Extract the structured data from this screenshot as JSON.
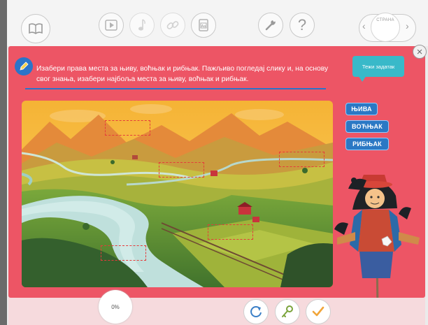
{
  "page_indicator": {
    "label": "СТРАНА"
  },
  "instruction": {
    "text": "Изабери права места за њиву, воћњак и рибњак. Пажљиво погледај слику и, на основу свог знања, изабери најбоља места за њиву, воћњак и рибњак."
  },
  "hard_task": {
    "label": "Тежи задатак"
  },
  "tags": [
    "ЊИВА",
    "ВОЋЊАК",
    "РИБЊАК"
  ],
  "progress": {
    "label": "0%"
  },
  "colors": {
    "card": "#ed5565",
    "tag": "#2b78c4",
    "hard_task": "#39b9c9",
    "pencil": "#2b74c9"
  }
}
